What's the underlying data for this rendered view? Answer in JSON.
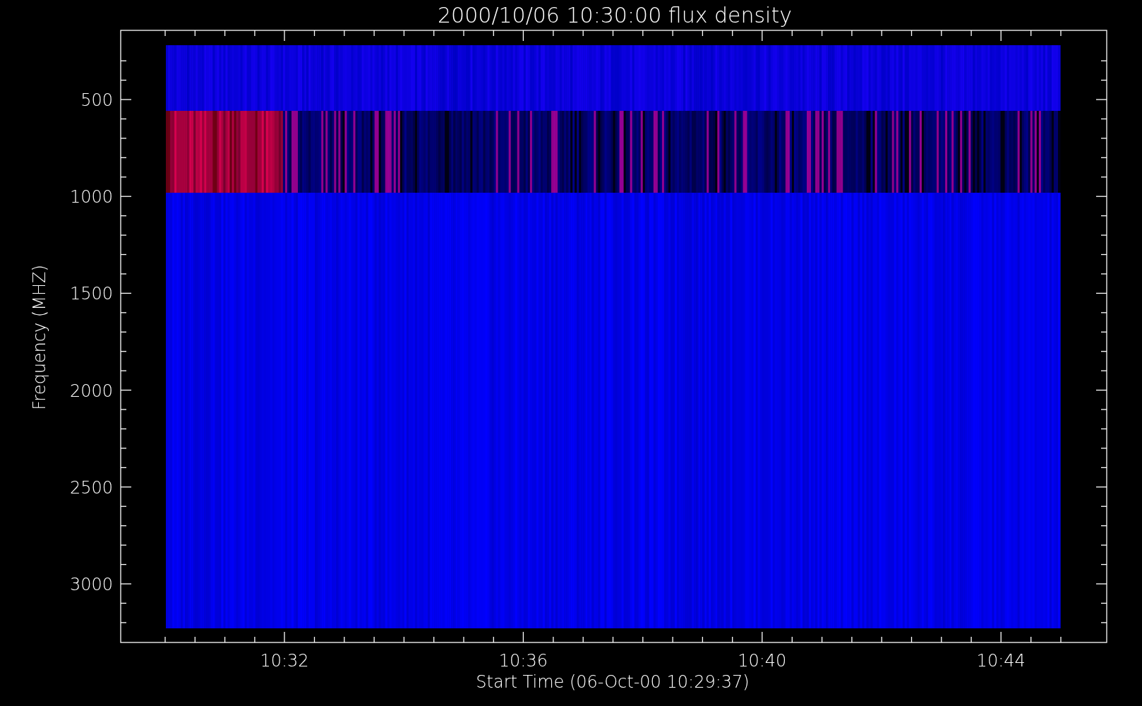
{
  "title": "2000/10/06 10:30:00 flux density",
  "y_axis": {
    "label": "Frequency (MHZ)",
    "ticks": [
      "500",
      "1000",
      "1500",
      "2000",
      "2500",
      "3000"
    ]
  },
  "x_axis": {
    "label": "Start Time (06-Oct-00 10:29:37)",
    "ticks": [
      "10:32",
      "10:36",
      "10:40",
      "10:44"
    ]
  }
}
